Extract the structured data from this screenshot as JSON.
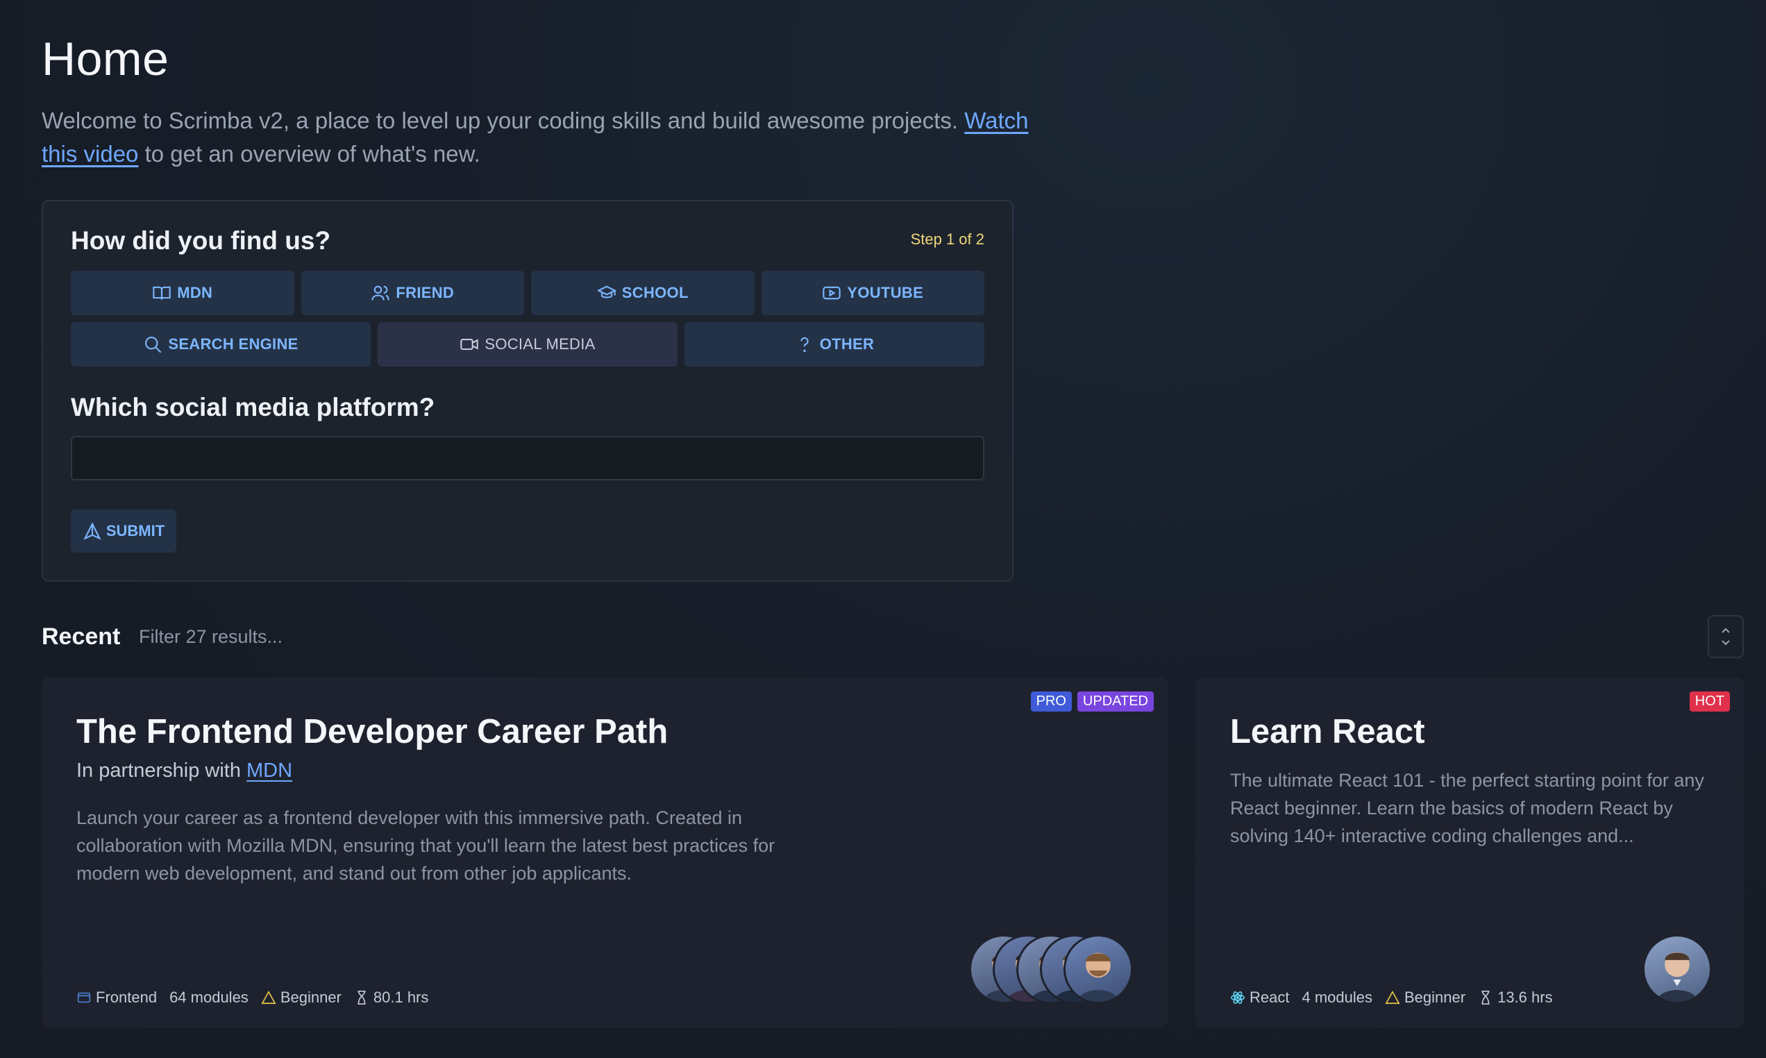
{
  "page": {
    "title": "Home",
    "intro_before": "Welcome to Scrimba v2, a place to level up your coding skills and build awesome projects. ",
    "intro_link": "Watch this video",
    "intro_after": " to get an overview of what's new."
  },
  "survey": {
    "title": "How did you find us?",
    "step": "Step 1 of 2",
    "options_row1": [
      {
        "label": "MDN",
        "icon": "book-icon"
      },
      {
        "label": "FRIEND",
        "icon": "users-icon"
      },
      {
        "label": "SCHOOL",
        "icon": "graduation-cap-icon"
      },
      {
        "label": "YOUTUBE",
        "icon": "youtube-icon"
      }
    ],
    "options_row2": [
      {
        "label": "SEARCH ENGINE",
        "icon": "search-icon"
      },
      {
        "label": "SOCIAL MEDIA",
        "icon": "video-camera-icon",
        "selected": true
      },
      {
        "label": "OTHER",
        "icon": "question-mark-icon"
      }
    ],
    "followup_question": "Which social media platform?",
    "followup_value": "",
    "submit_label": "SUBMIT"
  },
  "recent": {
    "label": "Recent",
    "filter_placeholder": "Filter 27 results..."
  },
  "courses": [
    {
      "title": "The Frontend Developer Career Path",
      "partner_prefix": "In partnership with ",
      "partner_link": "MDN",
      "description": "Launch your career as a frontend developer with this immersive path. Created in collaboration with Mozilla MDN, ensuring that you'll learn the latest best practices for modern web development, and stand out from other job applicants.",
      "badges": [
        "PRO",
        "UPDATED"
      ],
      "topic": "Frontend",
      "modules": "64 modules",
      "level": "Beginner",
      "duration": "80.1 hrs",
      "instructors": 5
    },
    {
      "title": "Learn React",
      "description": "The ultimate React 101 - the perfect starting point for any React beginner. Learn the basics of modern React by solving 140+ interactive coding challenges and...",
      "badges": [
        "HOT"
      ],
      "topic": "React",
      "modules": "4 modules",
      "level": "Beginner",
      "duration": "13.6 hrs",
      "instructors": 1
    }
  ],
  "colors": {
    "accent": "#7cb6ff",
    "link": "#6ea8fe",
    "step": "#f1d87a",
    "pro": "#3f5bd8",
    "updated": "#7a45de",
    "hot": "#e0314c",
    "level": "#e9c84a",
    "react": "#5fd3f3",
    "frontend": "#4f7fd6"
  }
}
